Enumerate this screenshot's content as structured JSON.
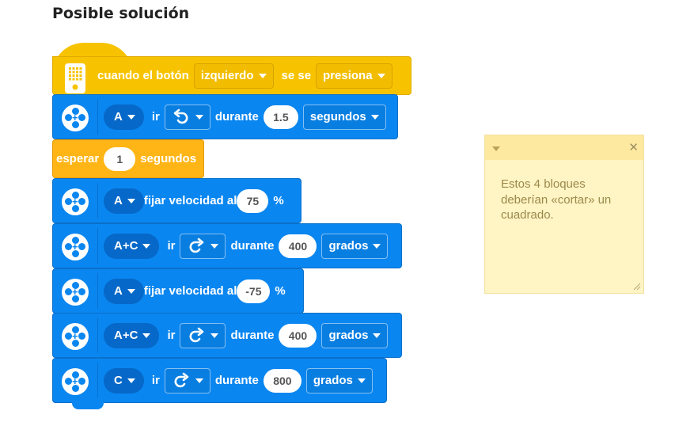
{
  "title": "Posible solución",
  "colors": {
    "motor_blue": "#0a86f0",
    "event_yellow": "#f7c300",
    "control_orange": "#ffb515",
    "note_bg": "#fff4c4"
  },
  "blocks": {
    "hat": {
      "label1": "cuando el botón",
      "button": "izquierdo",
      "label2": "se se",
      "action": "presiona"
    },
    "b1": {
      "port": "A",
      "verb": "ir",
      "dir_icon": "rotate-ccw-icon",
      "label": "durante",
      "value": "1.5",
      "unit": "segundos"
    },
    "wait": {
      "label1": "esperar",
      "value": "1",
      "label2": "segundos"
    },
    "b2": {
      "port": "A",
      "label": "fijar velocidad al",
      "value": "75",
      "unit": "%"
    },
    "b3": {
      "port": "A+C",
      "verb": "ir",
      "dir_icon": "rotate-cw-icon",
      "label": "durante",
      "value": "400",
      "unit": "grados"
    },
    "b4": {
      "port": "A",
      "label": "fijar velocidad al",
      "value": "-75",
      "unit": "%"
    },
    "b5": {
      "port": "A+C",
      "verb": "ir",
      "dir_icon": "rotate-cw-icon",
      "label": "durante",
      "value": "400",
      "unit": "grados"
    },
    "b6": {
      "port": "C",
      "verb": "ir",
      "dir_icon": "rotate-cw-icon",
      "label": "durante",
      "value": "800",
      "unit": "grados"
    }
  },
  "note": {
    "text": "Estos 4 bloques deberían «cortar» un cuadrado."
  }
}
